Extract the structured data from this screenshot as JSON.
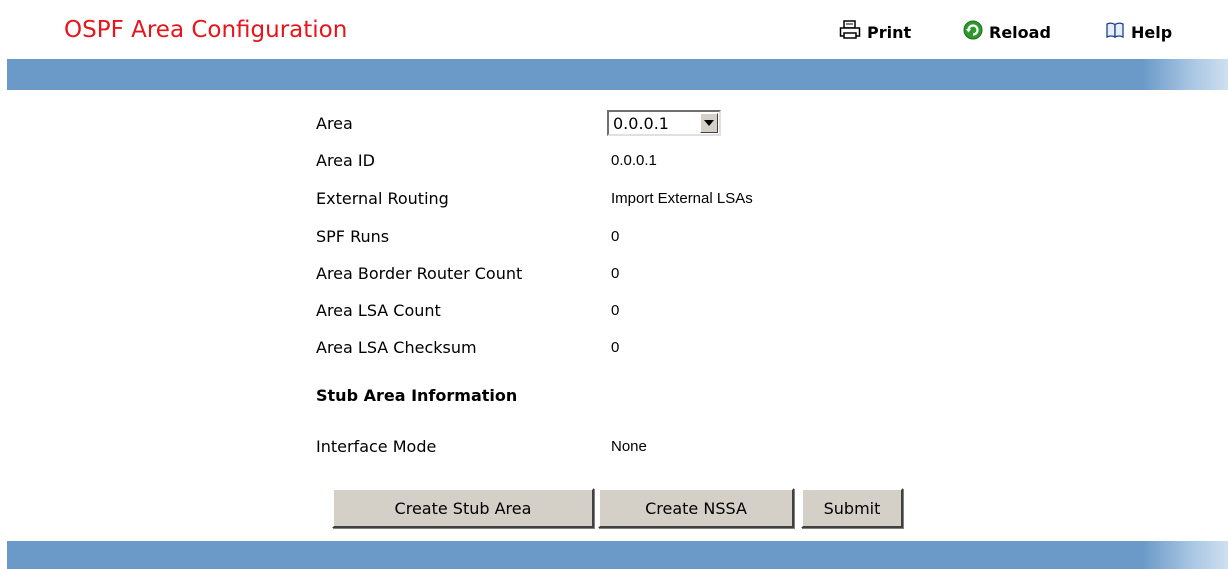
{
  "header": {
    "title": "OSPF Area Configuration",
    "print_label": "Print",
    "reload_label": "Reload",
    "help_label": "Help"
  },
  "colors": {
    "title": "#e8141b",
    "band": "#6b9ac9",
    "button_face": "#d4d0c8",
    "reload_icon": "#2e9a2e"
  },
  "icons": {
    "print": "printer-icon",
    "reload": "reload-icon",
    "help": "help-book-icon",
    "dropdown": "chevron-down-icon"
  },
  "form": {
    "area": {
      "label": "Area",
      "selected": "0.0.0.1"
    },
    "rows": [
      {
        "label": "Area ID",
        "value": "0.0.0.1"
      },
      {
        "label": "External Routing",
        "value": "Import External LSAs"
      },
      {
        "label": "SPF Runs",
        "value": "0"
      },
      {
        "label": "Area Border Router Count",
        "value": "0"
      },
      {
        "label": "Area LSA Count",
        "value": "0"
      },
      {
        "label": "Area LSA Checksum",
        "value": "0"
      }
    ],
    "stub_heading": "Stub Area Information",
    "interface_mode": {
      "label": "Interface Mode",
      "value": "None"
    }
  },
  "buttons": {
    "create_stub": "Create Stub Area",
    "create_nssa": "Create NSSA",
    "submit": "Submit"
  }
}
